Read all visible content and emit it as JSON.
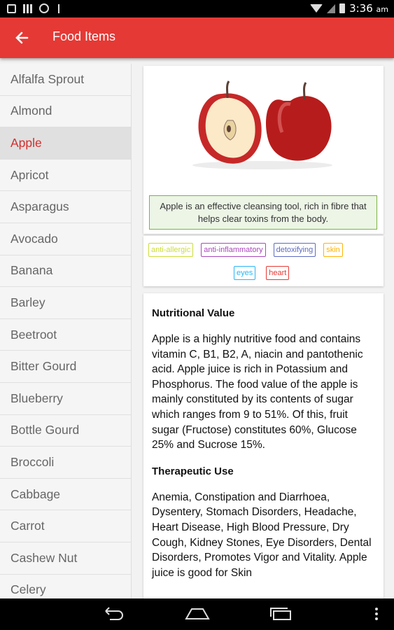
{
  "status_bar": {
    "time": "3:36",
    "ampm": "am"
  },
  "app_bar": {
    "title": "Food Items",
    "back_icon": "arrow-left-icon"
  },
  "sidebar": {
    "selected": "Apple",
    "items": [
      "Alfalfa Sprout",
      "Almond",
      "Apple",
      "Apricot",
      "Asparagus",
      "Avocado",
      "Banana",
      "Barley",
      "Beetroot",
      "Bitter Gourd",
      "Blueberry",
      "Bottle Gourd",
      "Broccoli",
      "Cabbage",
      "Carrot",
      "Cashew Nut",
      "Celery"
    ]
  },
  "detail": {
    "image": "apple-photo",
    "caption": "Apple is an effective cleansing tool, rich in fibre that helps clear toxins from the body.",
    "tags_row1": [
      {
        "label": "anti-allergic",
        "color": "#cddc39"
      },
      {
        "label": "anti-inflammatory",
        "color": "#ab47bc"
      },
      {
        "label": "detoxifying",
        "color": "#5c6bc0"
      },
      {
        "label": "skin",
        "color": "#ffb300"
      }
    ],
    "tags_row2": [
      {
        "label": "eyes",
        "color": "#29b6f6"
      },
      {
        "label": "heart",
        "color": "#e53935"
      }
    ],
    "nutritional_title": "Nutritional Value",
    "nutritional_body": "Apple is a highly nutritive food and contains vitamin C, B1, B2, A, niacin and pantothenic acid. Apple juice is rich in Potassium and Phosphorus. The food value of the apple is mainly constituted by its contents of sugar which ranges from 9 to 51%. Of this, fruit sugar (Fructose) constitutes 60%, Glucose 25% and Sucrose 15%.",
    "therapeutic_title": "Therapeutic Use",
    "therapeutic_body": "Anemia, Constipation and Diarrhoea, Dysentery, Stomach Disorders, Headache, Heart Disease, High Blood Pressure, Dry Cough, Kidney Stones, Eye Disorders, Dental Disorders, Promotes Vigor and Vitality. Apple juice is good for Skin"
  },
  "colors": {
    "accent": "#e53935",
    "selected_text": "#d32f2f",
    "caption_border": "#7cb342"
  },
  "nav_bar": {
    "back": "back-icon",
    "home": "home-icon",
    "recents": "recents-icon",
    "menu": "overflow-menu-icon"
  }
}
